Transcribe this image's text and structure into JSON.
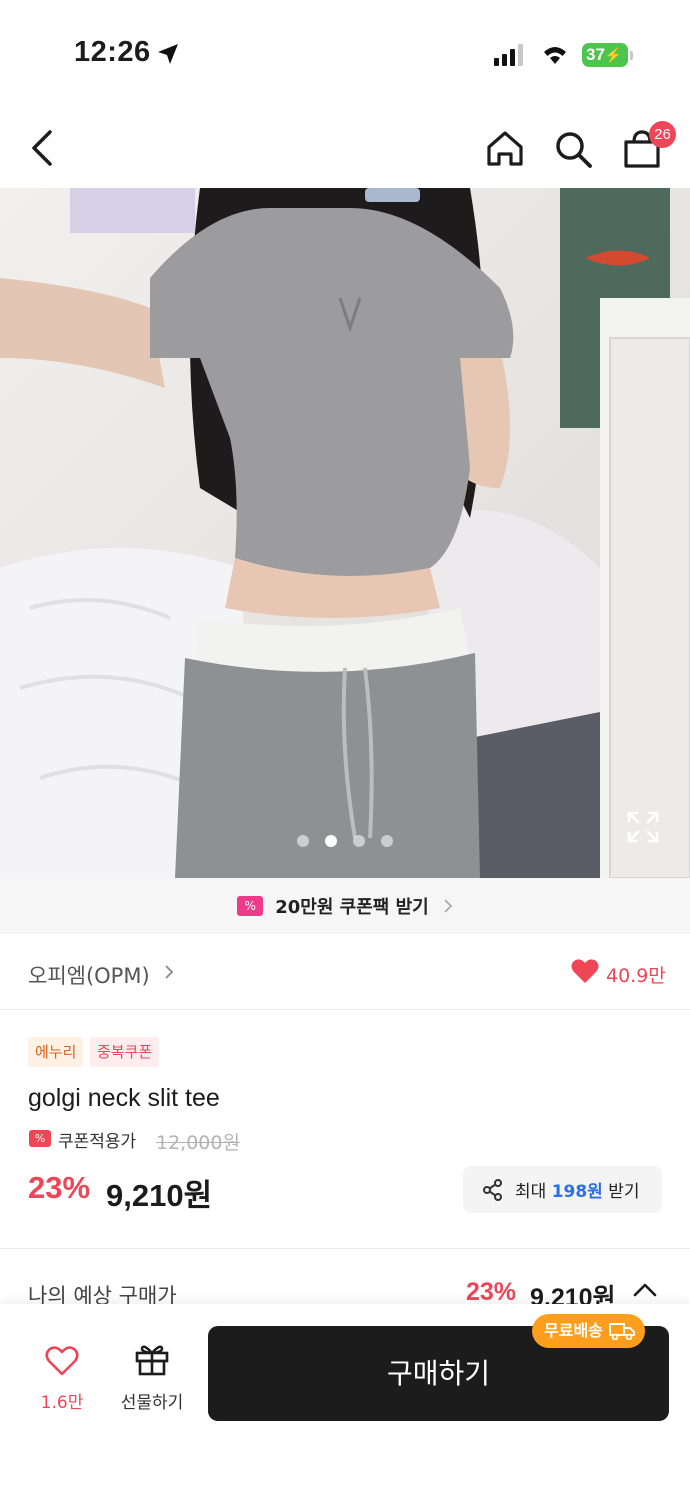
{
  "status_bar": {
    "time": "12:26",
    "battery": "37"
  },
  "header": {
    "cart_count": "26"
  },
  "product_image": {
    "alt": "Model wearing grey ribbed slit neck tee with grey sweatpants",
    "pages": 4,
    "active_page": 2
  },
  "coupon_banner": {
    "icon_text": "%",
    "text": "20만원 쿠폰팩 받기"
  },
  "brand": {
    "name": "오피엠(OPM)",
    "likes": "40.9만"
  },
  "tags": [
    "에누리",
    "중복쿠폰"
  ],
  "product": {
    "title": "golgi neck slit tee",
    "coupon_price_label": "쿠폰적용가",
    "original_price": "12,000원",
    "discount_rate": "23%",
    "sale_price": "9,210원"
  },
  "reward": {
    "prefix": "최대 ",
    "amount": "198원",
    "suffix": " 받기"
  },
  "expected": {
    "label": "나의 예상 구매가",
    "rate": "23%",
    "price": "9,210원"
  },
  "bottom_bar": {
    "wish_count": "1.6만",
    "gift_label": "선물하기",
    "buy_label": "구매하기",
    "free_shipping": "무료배송"
  },
  "colors": {
    "accent": "#ee4657",
    "dark": "#1c1c1c",
    "free_shipping": "#ff9d1c",
    "link_blue": "#2a6ee8"
  }
}
